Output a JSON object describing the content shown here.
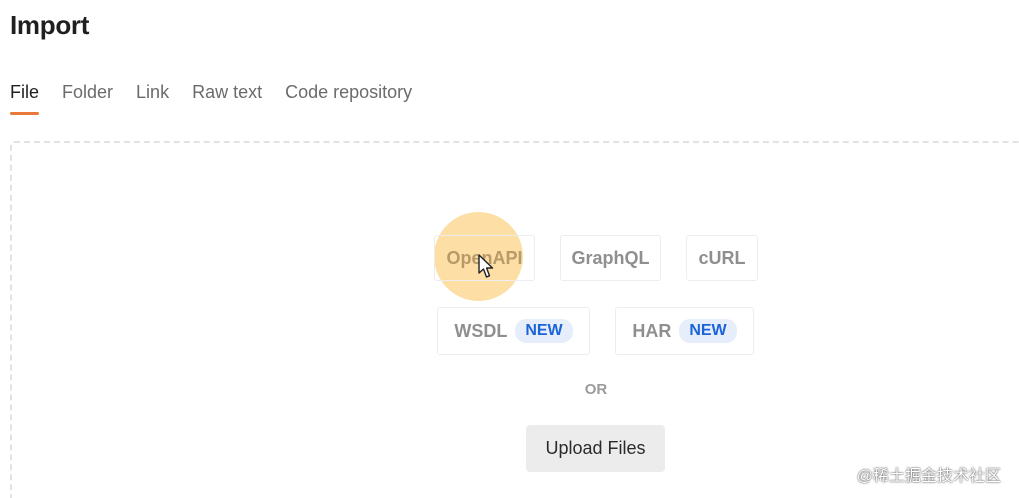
{
  "header": {
    "title": "Import"
  },
  "tabs": [
    {
      "label": "File",
      "active": true
    },
    {
      "label": "Folder",
      "active": false
    },
    {
      "label": "Link",
      "active": false
    },
    {
      "label": "Raw text",
      "active": false
    },
    {
      "label": "Code repository",
      "active": false
    }
  ],
  "formats": {
    "openapi": {
      "label": "OpenAPI"
    },
    "graphql": {
      "label": "GraphQL"
    },
    "curl": {
      "label": "cURL"
    },
    "wsdl": {
      "label": "WSDL",
      "badge": "NEW"
    },
    "har": {
      "label": "HAR",
      "badge": "NEW"
    }
  },
  "dropzone": {
    "or_text": "OR",
    "upload_label": "Upload Files"
  },
  "watermark": "@稀土掘金技术社区",
  "colors": {
    "accent": "#e8793b",
    "badge_text": "#1d63d8",
    "badge_bg": "#e6eefb",
    "highlight": "#fcd68c"
  }
}
